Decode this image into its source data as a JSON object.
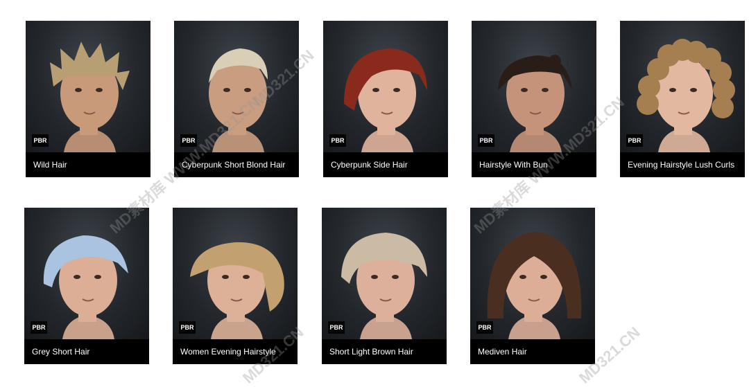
{
  "items": [
    {
      "name": "Wild Hair",
      "badge": "PBR",
      "hair": "#b79f73",
      "skin": "#c89a7a",
      "style": "spiky"
    },
    {
      "name": "Cyberpunk Short Blond Hair",
      "badge": "PBR",
      "hair": "#d9cfb6",
      "skin": "#c99d7f",
      "style": "slick"
    },
    {
      "name": "Cyberpunk Side Hair",
      "badge": "PBR",
      "hair": "#8a2a1c",
      "skin": "#e0b49c",
      "style": "side"
    },
    {
      "name": "Hairstyle With Bun",
      "badge": "PBR",
      "hair": "#2a1d17",
      "skin": "#c5937a",
      "style": "bun"
    },
    {
      "name": "Evening Hairstyle Lush Curls",
      "badge": "PBR",
      "hair": "#a57f4f",
      "skin": "#e3b8a0",
      "style": "curls"
    },
    {
      "name": "Grey Short Hair",
      "badge": "PBR",
      "hair": "#a9c3e0",
      "skin": "#dcae95",
      "style": "short"
    },
    {
      "name": "Women Evening Hairstyle",
      "badge": "PBR",
      "hair": "#c2a070",
      "skin": "#ddb198",
      "style": "updo"
    },
    {
      "name": "Short Light Brown Hair",
      "badge": "PBR",
      "hair": "#cbbba4",
      "skin": "#dcb09a",
      "style": "pixie"
    },
    {
      "name": "Mediven Hair",
      "badge": "PBR",
      "hair": "#4a2e1f",
      "skin": "#dcae98",
      "style": "bob"
    }
  ],
  "watermarks": [
    "MD素材库 WWW.MD321.CN",
    "MD素材库 WWW.MD321.CN",
    "MD321.CN",
    "MD321.CN",
    "MD321.CN"
  ]
}
